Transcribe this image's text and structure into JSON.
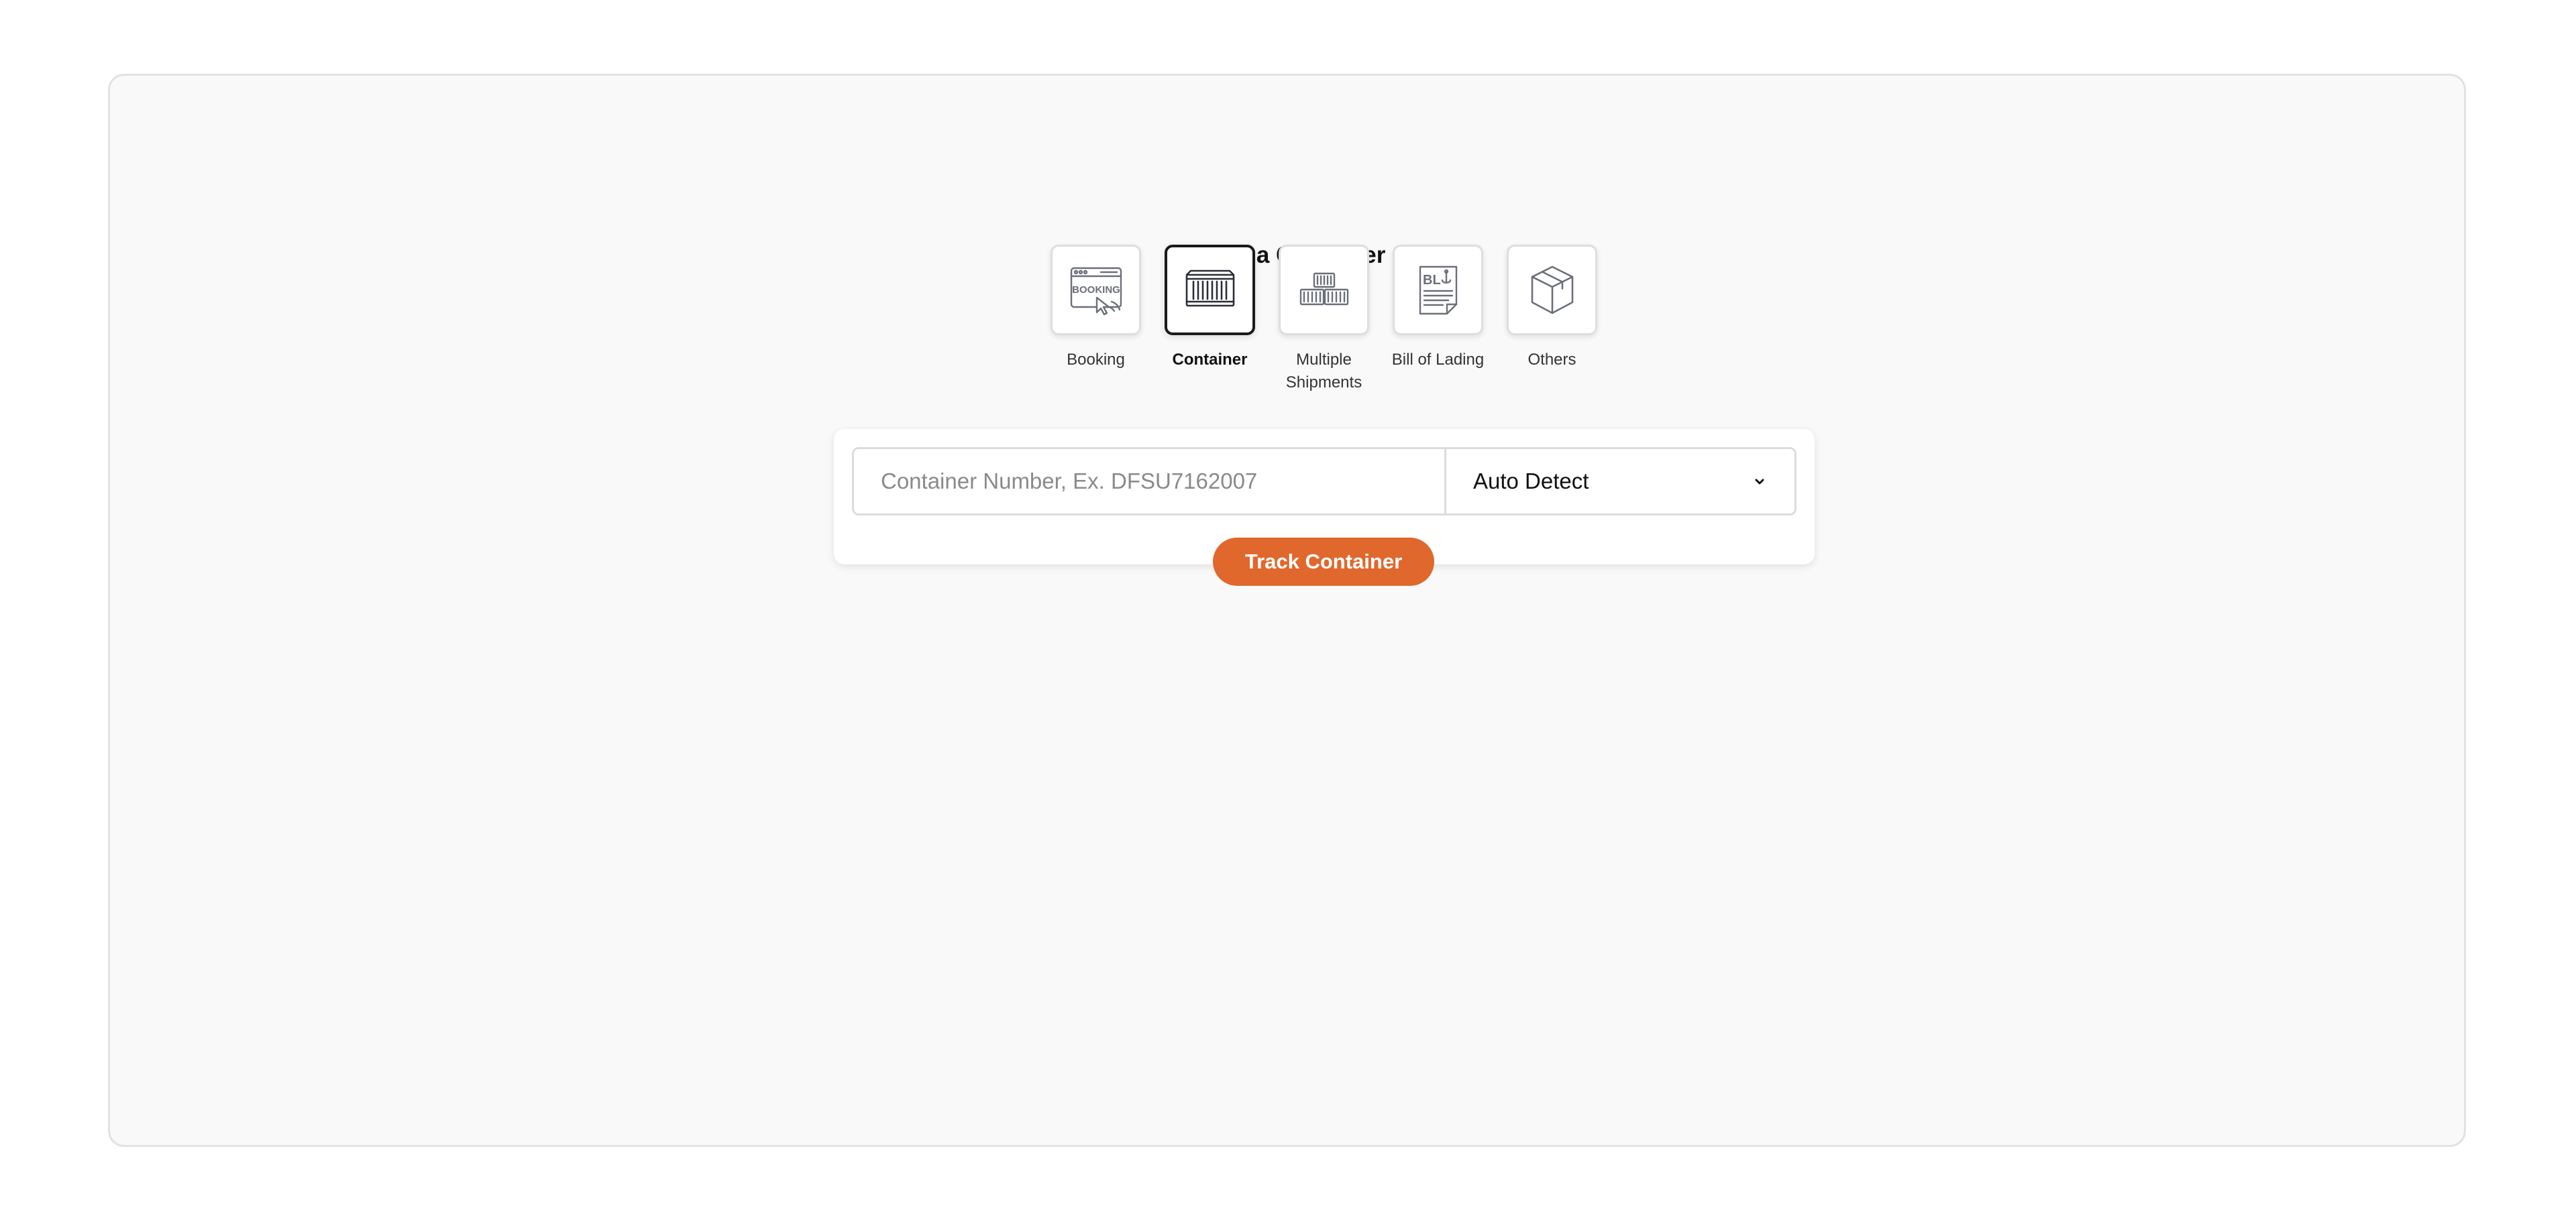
{
  "page": {
    "title": "Track a Container"
  },
  "types": [
    {
      "label": "Booking",
      "icon": "booking-icon"
    },
    {
      "label": "Container",
      "icon": "container-icon",
      "selected": true
    },
    {
      "label": "Multiple Shipments",
      "icon": "multiple-shipments-icon"
    },
    {
      "label": "Bill of Lading",
      "icon": "bill-of-lading-icon"
    },
    {
      "label": "Others",
      "icon": "box-icon"
    }
  ],
  "search": {
    "placeholder": "Container Number, Ex. DFSU7162007",
    "value": ""
  },
  "carrier_select": {
    "selected": "Auto Detect"
  },
  "track_button": {
    "label": "Track Container",
    "color": "#e0682d"
  },
  "colors": {
    "accent": "#e0682d",
    "card_background": "#f9f9f9",
    "selected_border": "#1a1a1a"
  }
}
